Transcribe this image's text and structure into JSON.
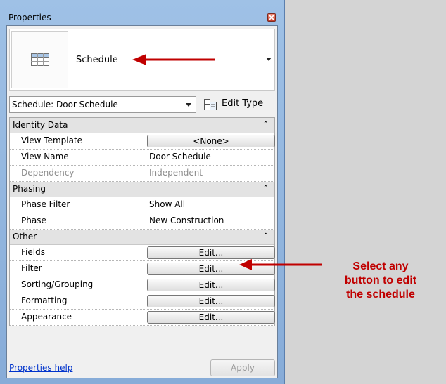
{
  "palette": {
    "title": "Properties",
    "type_selector": {
      "name": "Schedule"
    },
    "instance_selector": {
      "value": "Schedule: Door Schedule"
    },
    "edit_type_label": "Edit Type",
    "groups": [
      {
        "name": "Identity Data",
        "props": [
          {
            "name": "View Template",
            "value": "<None>",
            "kind": "button"
          },
          {
            "name": "View Name",
            "value": "Door Schedule",
            "kind": "text"
          },
          {
            "name": "Dependency",
            "value": "Independent",
            "kind": "disabled"
          }
        ]
      },
      {
        "name": "Phasing",
        "props": [
          {
            "name": "Phase Filter",
            "value": "Show All",
            "kind": "text"
          },
          {
            "name": "Phase",
            "value": "New Construction",
            "kind": "text"
          }
        ]
      },
      {
        "name": "Other",
        "props": [
          {
            "name": "Fields",
            "value": "Edit...",
            "kind": "button"
          },
          {
            "name": "Filter",
            "value": "Edit...",
            "kind": "button"
          },
          {
            "name": "Sorting/Grouping",
            "value": "Edit...",
            "kind": "button"
          },
          {
            "name": "Formatting",
            "value": "Edit...",
            "kind": "button"
          },
          {
            "name": "Appearance",
            "value": "Edit...",
            "kind": "button"
          }
        ]
      }
    ],
    "help_link": "Properties help",
    "apply_label": "Apply"
  },
  "annotation": {
    "callout_lines": [
      "Select any",
      "button to edit",
      "the schedule"
    ],
    "color": "#c00000"
  },
  "icons": [
    "close-icon",
    "schedule-table-icon",
    "dropdown-arrow-icon",
    "edit-type-icon",
    "collapse-chevron-icon",
    "annotation-arrow-icon"
  ]
}
